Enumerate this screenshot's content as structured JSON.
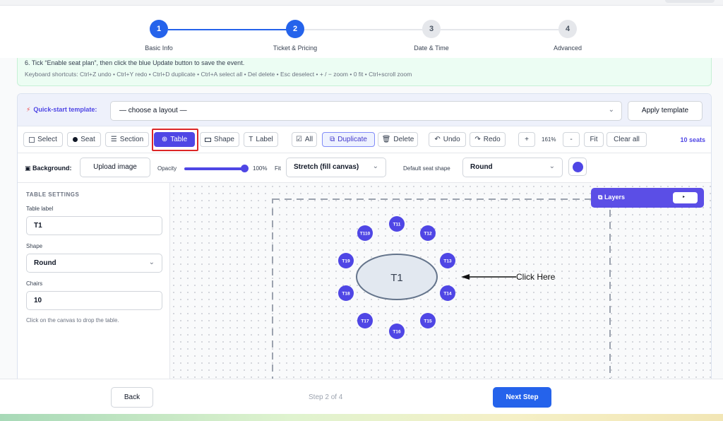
{
  "stepper": {
    "steps": [
      {
        "number": "1",
        "label": "Basic Info",
        "state": "done"
      },
      {
        "number": "2",
        "label": "Ticket & Pricing",
        "state": "active"
      },
      {
        "number": "3",
        "label": "Date & Time",
        "state": "upcoming"
      },
      {
        "number": "4",
        "label": "Advanced",
        "state": "upcoming"
      }
    ]
  },
  "notice": {
    "instruction": "6. Tick “Enable seat plan”, then click the blue Update button to save the event.",
    "shortcuts": "Keyboard shortcuts: Ctrl+Z undo • Ctrl+Y redo • Ctrl+D duplicate • Ctrl+A select all • Del delete • Esc deselect • + / − zoom • 0 fit • Ctrl+scroll zoom"
  },
  "quick_start": {
    "label": "Quick-start template:",
    "select_value": "— choose a layout —",
    "apply_button": "Apply template"
  },
  "toolbar": {
    "select": "Select",
    "seat": "Seat",
    "section": "Section",
    "table": "Table",
    "shape": "Shape",
    "label": "Label",
    "all": "All",
    "duplicate": "Duplicate",
    "delete": "Delete",
    "undo": "Undo",
    "redo": "Redo",
    "zoom_in": "+",
    "zoom_level": "161%",
    "zoom_out": "-",
    "fit": "Fit",
    "clear_all": "Clear all",
    "seat_count": "10 seats"
  },
  "background": {
    "label": "Background:",
    "upload_button": "Upload image",
    "opacity_label": "Opacity",
    "opacity_value": "100%",
    "fit_label": "Fit",
    "fit_value": "Stretch (fill canvas)",
    "seat_shape_label": "Default seat shape",
    "seat_shape_value": "Round",
    "seat_color": "#4f46e5"
  },
  "table_settings": {
    "heading": "TABLE SETTINGS",
    "table_label_label": "Table label",
    "table_label_value": "T1",
    "shape_label": "Shape",
    "shape_value": "Round",
    "chairs_label": "Chairs",
    "chairs_value": "10",
    "hint": "Click on the canvas to drop the table."
  },
  "canvas": {
    "layers_label": "Layers",
    "layers_toggle": "▸",
    "table_name": "T1",
    "chairs": [
      "T11",
      "T12",
      "T13",
      "T14",
      "T15",
      "T16",
      "T17",
      "T18",
      "T19",
      "T110"
    ],
    "annotation": "Click Here"
  },
  "footer": {
    "back": "Back",
    "step_indicator": "Step 2 of 4",
    "next": "Next Step"
  },
  "colors": {
    "primary": "#2563eb",
    "accent": "#4f46e5",
    "highlight_box": "#dc2626"
  }
}
